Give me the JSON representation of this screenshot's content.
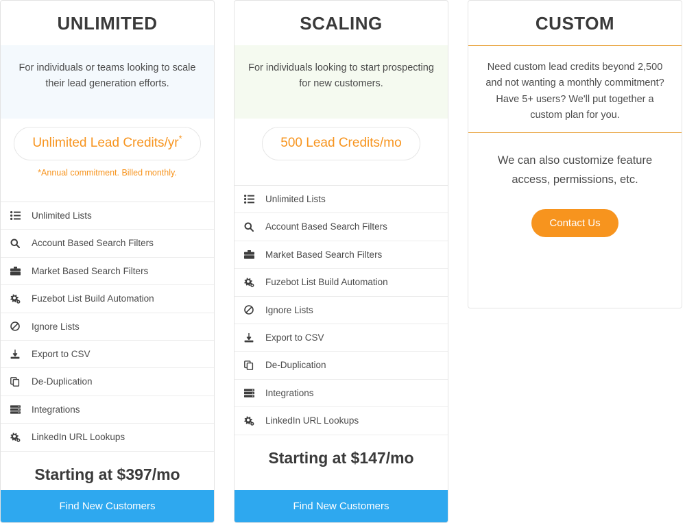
{
  "plans": [
    {
      "id": "unlimited",
      "title": "UNLIMITED",
      "description": "For individuals or teams looking to scale their lead generation efforts.",
      "credits_label": "Unlimited Lead Credits/yr",
      "credits_star": "*",
      "credits_note": "*Annual commitment. Billed monthly.",
      "desc_background": "#f4f9fd",
      "price": "Starting at $397/mo",
      "cta_label": "Find New Customers",
      "cta_color": "#2ea8ef",
      "features": [
        {
          "icon": "list-icon",
          "label": "Unlimited Lists"
        },
        {
          "icon": "search-icon",
          "label": "Account Based Search Filters"
        },
        {
          "icon": "briefcase-icon",
          "label": "Market Based Search Filters"
        },
        {
          "icon": "cogs-icon",
          "label": "Fuzebot List Build Automation"
        },
        {
          "icon": "ban-icon",
          "label": "Ignore Lists"
        },
        {
          "icon": "download-icon",
          "label": "Export to CSV"
        },
        {
          "icon": "copy-icon",
          "label": "De-Duplication"
        },
        {
          "icon": "server-icon",
          "label": "Integrations"
        },
        {
          "icon": "cogs-icon",
          "label": "LinkedIn URL Lookups"
        }
      ]
    },
    {
      "id": "scaling",
      "title": "SCALING",
      "description": "For individuals looking to start prospecting for new customers.",
      "credits_label": "500 Lead Credits/mo",
      "credits_star": "",
      "credits_note": "",
      "desc_background": "#f5faf0",
      "price": "Starting at $147/mo",
      "cta_label": "Find New Customers",
      "cta_color": "#2ea8ef",
      "features": [
        {
          "icon": "list-icon",
          "label": "Unlimited Lists"
        },
        {
          "icon": "search-icon",
          "label": "Account Based Search Filters"
        },
        {
          "icon": "briefcase-icon",
          "label": "Market Based Search Filters"
        },
        {
          "icon": "cogs-icon",
          "label": "Fuzebot List Build Automation"
        },
        {
          "icon": "ban-icon",
          "label": "Ignore Lists"
        },
        {
          "icon": "download-icon",
          "label": "Export to CSV"
        },
        {
          "icon": "copy-icon",
          "label": "De-Duplication"
        },
        {
          "icon": "server-icon",
          "label": "Integrations"
        },
        {
          "icon": "cogs-icon",
          "label": "LinkedIn URL Lookups"
        }
      ]
    },
    {
      "id": "custom",
      "title": "CUSTOM",
      "description": "Need custom lead credits beyond 2,500 and not wanting a monthly commitment? Have 5+ users? We'll put together a custom plan for you.",
      "divider_color": "#e8a33d",
      "note": "We can also customize feature access, permissions, etc.",
      "cta_label": "Contact Us",
      "cta_color": "#f7941e"
    }
  ],
  "accent": {
    "orange": "#f7941e",
    "blue": "#2ea8ef",
    "title_gray": "#3a3a3a"
  }
}
